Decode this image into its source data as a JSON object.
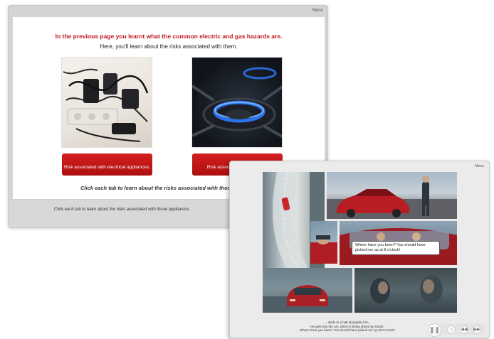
{
  "window_back": {
    "menu": "Menu",
    "heading": "In the previous page you learnt what the common electric and gas hazards are.",
    "subheading": "Here, you'll learn about the risks associated with them.",
    "button_electrical": "Risk associated with electrical appliances.",
    "button_gas": "Risk associated with gas appl",
    "instruction": "Click each tab to learn about the risks associated with those",
    "caption": "Click each tab to learn about the risks associated with those appliances."
  },
  "window_front": {
    "menu": "Menu",
    "speech": "Where have you been? You should have picked me up at 8 o'clock!",
    "caption_line1": "...skids to a halt alongside him.",
    "caption_line2": "He gets into the car, which is being driven by Sarah.",
    "caption_line3": "Where have you been? You should have picked me up at 8 o'clock!",
    "controls": {
      "play_pause": "❚❚",
      "replay": "○",
      "back": "◀◀",
      "forward": "▶▶"
    }
  }
}
